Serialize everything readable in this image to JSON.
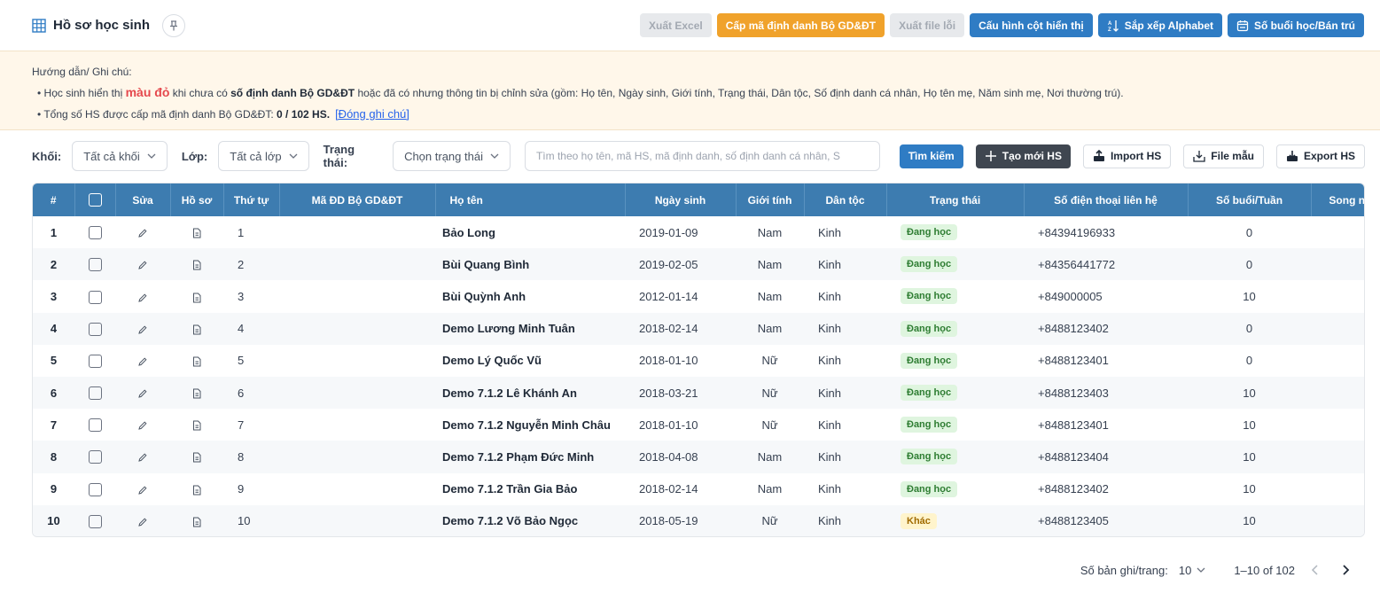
{
  "header": {
    "title": "Hồ sơ học sinh",
    "buttons": {
      "export_excel": "Xuất Excel",
      "issue_id": "Cấp mã định danh Bộ GD&ĐT",
      "export_error": "Xuất file lỗi",
      "config_columns": "Cấu hình cột hiển thị",
      "sort_alpha": "Sắp xếp Alphabet",
      "sessions": "Số buổi học/Bán trú"
    }
  },
  "notes": {
    "heading": "Hướng dẫn/ Ghi chú:",
    "line1_prefix": "• Học sinh hiển thị ",
    "line1_red": "màu đỏ",
    "line1_mid": " khi chưa có ",
    "line1_bold": "số định danh Bộ GD&ĐT",
    "line1_suffix": " hoặc đã có nhưng thông tin bị chỉnh sửa (gồm: Họ tên, Ngày sinh, Giới tính, Trạng thái, Dân tộc, Số định danh cá nhân, Họ tên mẹ, Năm sinh mẹ, Nơi thường trú).",
    "line2_prefix": "• Tổng số HS được cấp mã định danh Bộ GD&ĐT: ",
    "line2_bold": "0 / 102 HS.",
    "close_link": "[Đóng ghi chú]"
  },
  "filters": {
    "grade_label": "Khối:",
    "grade_value": "Tất cả khối",
    "class_label": "Lớp:",
    "class_value": "Tất cả lớp",
    "status_label": "Trạng thái:",
    "status_placeholder": "Chọn trạng thái",
    "search_placeholder": "Tìm theo họ tên, mã HS, mã định danh, số định danh cá nhân, S",
    "search_button": "Tìm kiếm",
    "create_button": "Tạo mới HS",
    "import_button": "Import HS",
    "template_button": "File mẫu",
    "export_button": "Export HS"
  },
  "table": {
    "headers": {
      "index": "#",
      "edit": "Sửa",
      "profile": "Hồ sơ",
      "order": "Thứ tự",
      "moet_id": "Mã ĐD Bộ GD&ĐT",
      "name": "Họ tên",
      "dob": "Ngày sinh",
      "gender": "Giới tính",
      "ethnicity": "Dân tộc",
      "status": "Trạng thái",
      "phone": "Số điện thoại liên hệ",
      "sessions": "Số buổi/Tuần",
      "bilingual": "Song ngữ"
    },
    "rows": [
      {
        "index": "1",
        "order": "1",
        "name": "Bảo Long",
        "dob": "2019-01-09",
        "gender": "Nam",
        "ethnicity": "Kinh",
        "status": "Đang học",
        "status_type": "ok",
        "phone": "+84394196933",
        "sessions": "0"
      },
      {
        "index": "2",
        "order": "2",
        "name": "Bùi Quang Bình",
        "dob": "2019-02-05",
        "gender": "Nam",
        "ethnicity": "Kinh",
        "status": "Đang học",
        "status_type": "ok",
        "phone": "+84356441772",
        "sessions": "0"
      },
      {
        "index": "3",
        "order": "3",
        "name": "Bùi Quỳnh Anh",
        "dob": "2012-01-14",
        "gender": "Nam",
        "ethnicity": "Kinh",
        "status": "Đang học",
        "status_type": "ok",
        "phone": "+849000005",
        "sessions": "10"
      },
      {
        "index": "4",
        "order": "4",
        "name": "Demo Lương Minh Tuân",
        "dob": "2018-02-14",
        "gender": "Nam",
        "ethnicity": "Kinh",
        "status": "Đang học",
        "status_type": "ok",
        "phone": "+8488123402",
        "sessions": "0"
      },
      {
        "index": "5",
        "order": "5",
        "name": "Demo Lý Quốc Vũ",
        "dob": "2018-01-10",
        "gender": "Nữ",
        "ethnicity": "Kinh",
        "status": "Đang học",
        "status_type": "ok",
        "phone": "+8488123401",
        "sessions": "0"
      },
      {
        "index": "6",
        "order": "6",
        "name": "Demo 7.1.2 Lê Khánh An",
        "dob": "2018-03-21",
        "gender": "Nữ",
        "ethnicity": "Kinh",
        "status": "Đang học",
        "status_type": "ok",
        "phone": "+8488123403",
        "sessions": "10"
      },
      {
        "index": "7",
        "order": "7",
        "name": "Demo 7.1.2 Nguyễn Minh Châu",
        "dob": "2018-01-10",
        "gender": "Nữ",
        "ethnicity": "Kinh",
        "status": "Đang học",
        "status_type": "ok",
        "phone": "+8488123401",
        "sessions": "10"
      },
      {
        "index": "8",
        "order": "8",
        "name": "Demo 7.1.2 Phạm Đức Minh",
        "dob": "2018-04-08",
        "gender": "Nam",
        "ethnicity": "Kinh",
        "status": "Đang học",
        "status_type": "ok",
        "phone": "+8488123404",
        "sessions": "10"
      },
      {
        "index": "9",
        "order": "9",
        "name": "Demo 7.1.2 Trần Gia Bảo",
        "dob": "2018-02-14",
        "gender": "Nam",
        "ethnicity": "Kinh",
        "status": "Đang học",
        "status_type": "ok",
        "phone": "+8488123402",
        "sessions": "10"
      },
      {
        "index": "10",
        "order": "10",
        "name": "Demo 7.1.2 Võ Bảo Ngọc",
        "dob": "2018-05-19",
        "gender": "Nữ",
        "ethnicity": "Kinh",
        "status": "Khác",
        "status_type": "other",
        "phone": "+8488123405",
        "sessions": "10"
      }
    ]
  },
  "pagination": {
    "page_size_label": "Số bản ghi/trang:",
    "page_size": "10",
    "range": "1–10 of 102"
  },
  "colors": {
    "table_header": "#3d7cb0",
    "primary": "#2f7cc4",
    "accent_orange": "#f0a22b",
    "notes_bg": "#fff7ea"
  },
  "icons": {
    "title": "grid-table-icon",
    "pin": "pin-icon",
    "edit": "pencil-icon",
    "profile": "document-icon",
    "import": "upload-icon",
    "export": "download-icon"
  }
}
